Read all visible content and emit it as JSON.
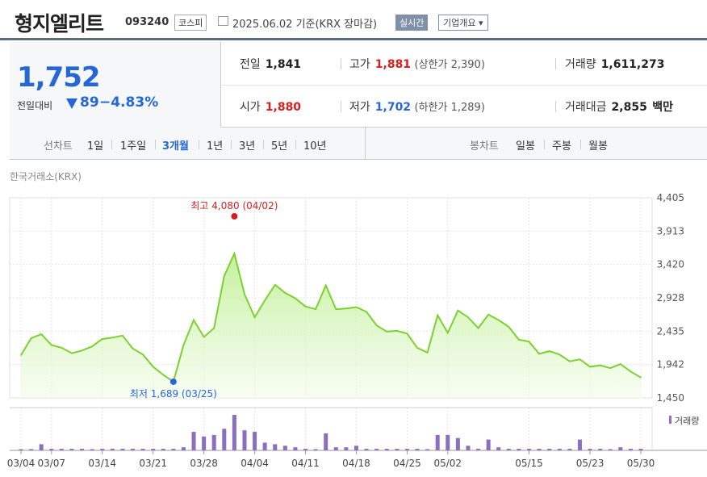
{
  "header": {
    "name": "형지엘리트",
    "code": "093240",
    "market": "코스피",
    "date": "2025.06.02 기준(KRX 장마감)",
    "live": "실시간",
    "corp": "기업개요 ▾"
  },
  "quote": {
    "price": "1,752",
    "change_label": "전일대비",
    "change": "89",
    "change_pct": "−4.83%",
    "prev_label": "전일",
    "prev": "1,841",
    "high_label": "고가",
    "high": "1,881",
    "upper_limit": "(상한가 2,390)",
    "volume_label": "거래량",
    "volume": "1,611,273",
    "open_label": "시가",
    "open": "1,880",
    "low_label": "저가",
    "low": "1,702",
    "lower_limit": "(하한가 1,289)",
    "value_label": "거래대금",
    "value": "2,855",
    "value_unit": "백만"
  },
  "tabs": {
    "line_label": "선차트",
    "line": [
      "1일",
      "1주일",
      "3개월",
      "1년",
      "3년",
      "5년",
      "10년"
    ],
    "active": "3개월",
    "candle_label": "봉차트",
    "candle": [
      "일봉",
      "주봉",
      "월봉"
    ]
  },
  "source": "한국거래소(KRX)",
  "colors": {
    "up": "#d51f1f",
    "down": "#2567d8",
    "line": "#7cd12e",
    "volume": "#8a6fc0"
  },
  "chart_data": {
    "type": "area",
    "y_ticks": [
      "4,405",
      "3,913",
      "3,420",
      "2,928",
      "2,435",
      "1,942",
      "1,450"
    ],
    "ylim": [
      1450,
      4405
    ],
    "x_labels": [
      "03/04",
      "03/07",
      "03/14",
      "03/21",
      "03/28",
      "04/04",
      "04/11",
      "04/18",
      "04/25",
      "05/02",
      "05/15",
      "05/23",
      "05/30"
    ],
    "label_index": [
      0,
      3,
      8,
      13,
      18,
      23,
      28,
      33,
      38,
      42,
      50,
      56,
      61
    ],
    "values": [
      2080,
      2330,
      2390,
      2230,
      2190,
      2110,
      2150,
      2210,
      2320,
      2340,
      2370,
      2180,
      2090,
      1910,
      1790,
      1689,
      2230,
      2600,
      2350,
      2480,
      3250,
      3580,
      2980,
      2640,
      2890,
      3120,
      3000,
      2920,
      2800,
      2760,
      3110,
      2760,
      2770,
      2790,
      2720,
      2520,
      2430,
      2440,
      2400,
      2190,
      2120,
      2670,
      2410,
      2740,
      2640,
      2480,
      2680,
      2600,
      2500,
      2310,
      2280,
      2100,
      2140,
      2090,
      1990,
      2020,
      1910,
      1930,
      1890,
      1950,
      1840,
      1752
    ],
    "volume": [
      0,
      0,
      4,
      1,
      1,
      1,
      1,
      0,
      1,
      1,
      1,
      1,
      1,
      1,
      1,
      1,
      2,
      12,
      9,
      10,
      14,
      23,
      13,
      12,
      5,
      4,
      3,
      2,
      1,
      0,
      11,
      2,
      2,
      3,
      1,
      1,
      1,
      1,
      1,
      1,
      0,
      10,
      10,
      8,
      3,
      1,
      7,
      2,
      1,
      1,
      1,
      1,
      1,
      1,
      1,
      7,
      1,
      1,
      0,
      2,
      1,
      1
    ],
    "max_label": "최고 4,080 (04/02)",
    "min_label": "최저 1,689 (03/25)",
    "max_index": 21,
    "min_index": 15,
    "volume_legend": "거래량"
  }
}
